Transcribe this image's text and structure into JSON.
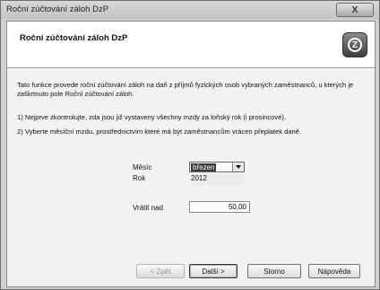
{
  "window": {
    "title": "Roční zúčtování záloh DzP",
    "close_label": "X"
  },
  "header": {
    "title": "Roční zúčtování záloh DzP",
    "logo_glyph": "Z"
  },
  "body": {
    "paragraph1": "Tato funkce provede roční zúčtování záloh na daň z příjmů fyzických osob vybraných zaměstnanců, u kterých je zaškrtnuto pole Roční zúčtování záloh.",
    "step1": "1) Nejprve zkontrolujte, zda jsou již vystaveny všechny mzdy za loňský rok (i prosincové).",
    "step2": "2) Vyberte měsíční mzdu, prostřednictvím které má být zaměstnancům vrácen přeplatek daně."
  },
  "form": {
    "month_label": "Měsíc",
    "month_value": "březen",
    "year_label": "Rok",
    "year_value": "2012",
    "refund_label": "Vrátit nad",
    "refund_value": "50,00"
  },
  "buttons": {
    "back": "< Zpět",
    "next": "Další >",
    "cancel": "Storno",
    "help": "Nápověda"
  }
}
